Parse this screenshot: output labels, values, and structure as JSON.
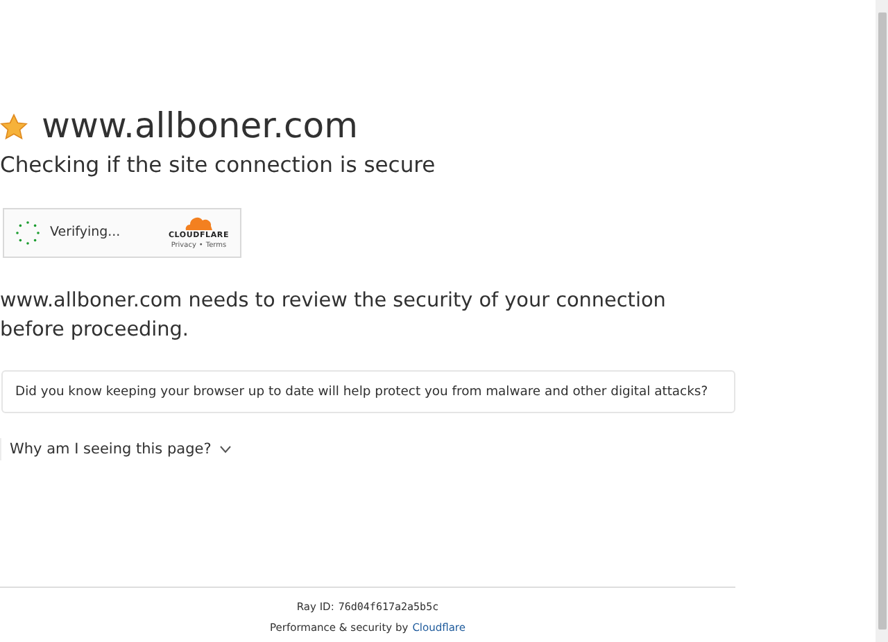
{
  "site": {
    "domain": "www.allboner.com",
    "subtitle": "Checking if the site connection is secure"
  },
  "widget": {
    "status": "Verifying...",
    "brand": "CLOUDFLARE",
    "privacy": "Privacy",
    "separator": "•",
    "terms": "Terms"
  },
  "message": "www.allboner.com needs to review the security of your connection before proceeding.",
  "tip": "Did you know keeping your browser up to date will help protect you from malware and other digital attacks?",
  "why": {
    "label": "Why am I seeing this page?",
    "expanded": false
  },
  "footer": {
    "ray_label": "Ray ID:",
    "ray_id": "76d04f617a2a5b5c",
    "perf": "Performance & security by",
    "link": "Cloudflare"
  }
}
